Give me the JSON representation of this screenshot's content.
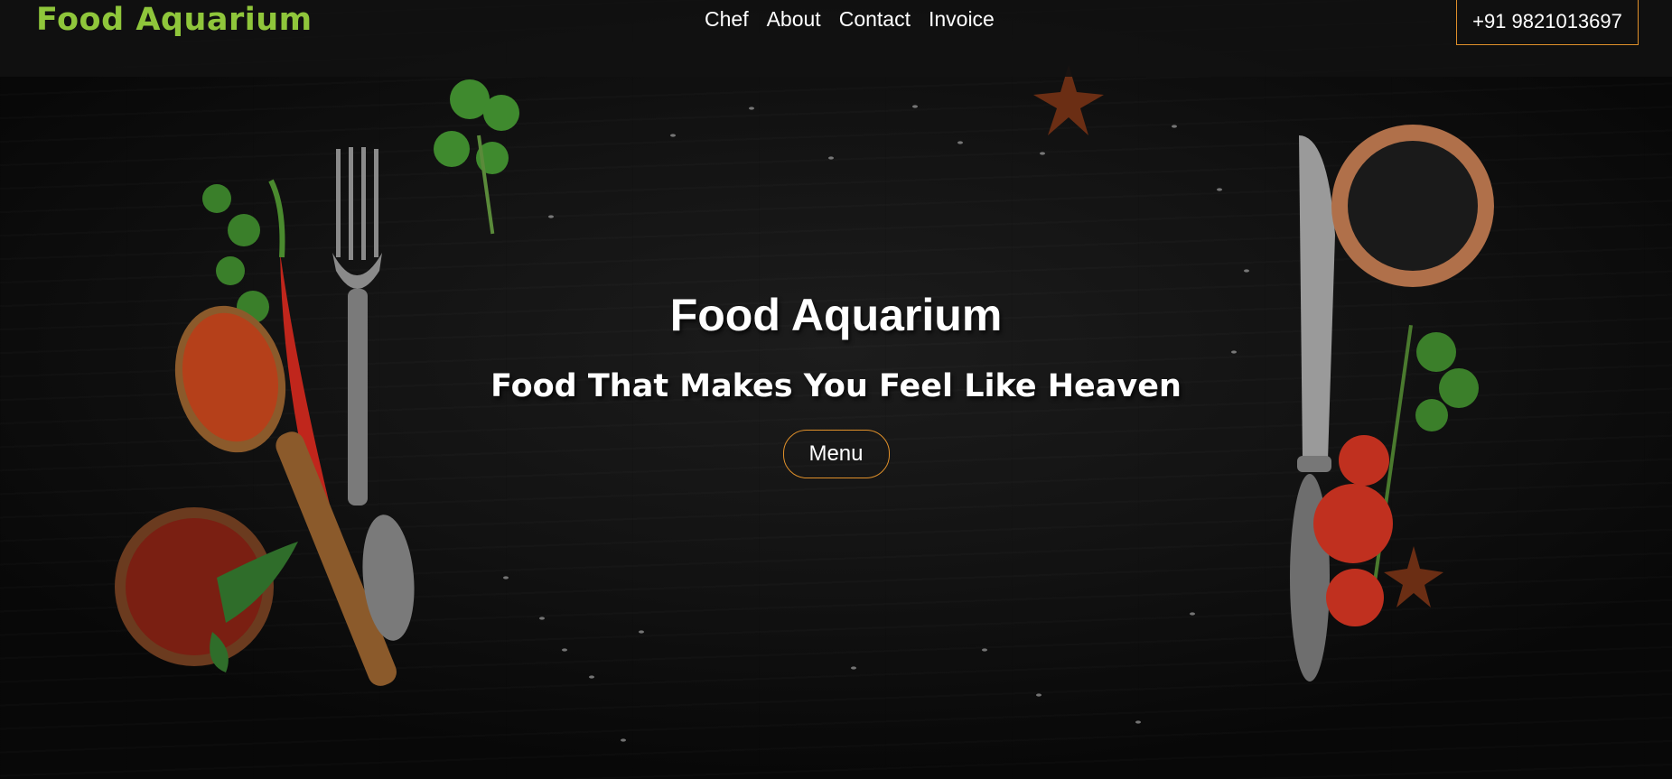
{
  "navbar": {
    "brand": "Food Aquarium",
    "links": [
      "Chef",
      "About",
      "Contact",
      "Invoice"
    ],
    "phone": "+91 9821013697"
  },
  "hero": {
    "title": "Food Aquarium",
    "subtitle": "Food That Makes You Feel Like Heaven",
    "button_label": "Menu"
  },
  "colors": {
    "brand": "#8fc63b",
    "accent_border": "#e0902a",
    "background": "#111111"
  }
}
